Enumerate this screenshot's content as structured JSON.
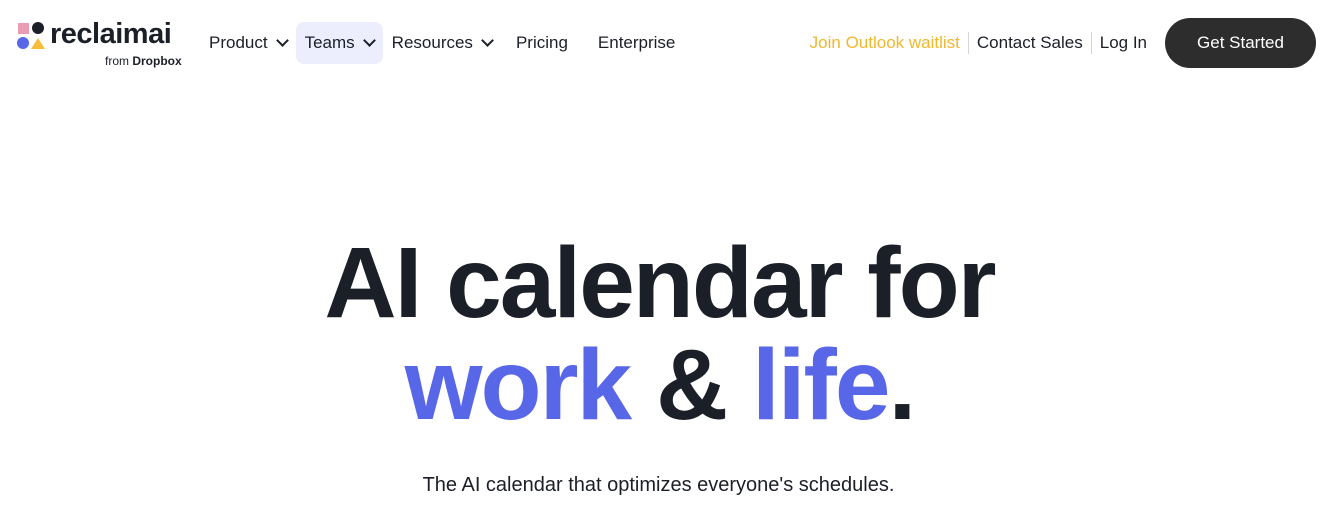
{
  "brand": {
    "name": "reclaimai",
    "from_prefix": "from",
    "from_company": "Dropbox",
    "colors": {
      "pink": "#ea9cb5",
      "dark": "#1b1f27",
      "blue": "#5867e8",
      "yellow": "#f6bf3a"
    }
  },
  "nav": {
    "items": [
      {
        "label": "Product",
        "has_dropdown": true,
        "icon": "chevron-down-icon"
      },
      {
        "label": "Teams",
        "has_dropdown": true,
        "icon": "chevron-down-icon",
        "active": true
      },
      {
        "label": "Resources",
        "has_dropdown": true,
        "icon": "chevron-down-icon"
      },
      {
        "label": "Pricing",
        "has_dropdown": false
      },
      {
        "label": "Enterprise",
        "has_dropdown": false
      }
    ],
    "right_links": [
      {
        "label": "Join Outlook waitlist",
        "color": "#f1b82d"
      },
      {
        "label": "Contact Sales"
      },
      {
        "label": "Log In"
      }
    ],
    "cta_label": "Get Started"
  },
  "hero": {
    "line1": "AI calendar for",
    "line2_part1": "work",
    "line2_part2": " & ",
    "line2_part3": "life",
    "line2_part4": ".",
    "accent_color": "#5867e8",
    "subtitle": "The AI calendar that optimizes everyone's schedules."
  }
}
